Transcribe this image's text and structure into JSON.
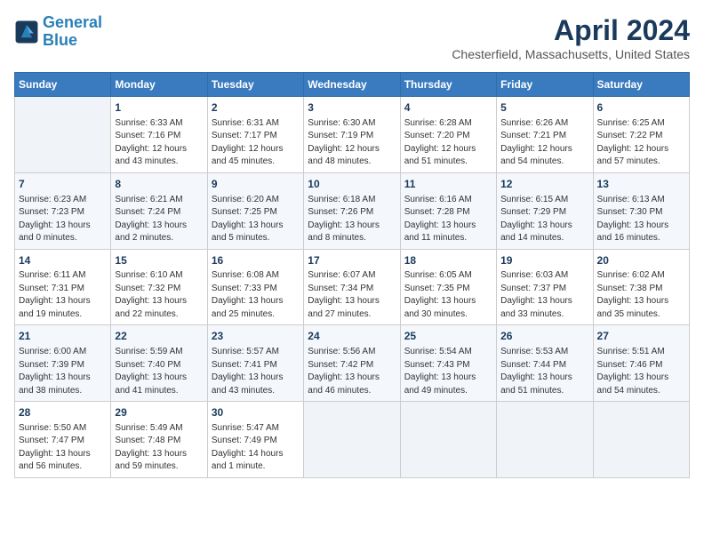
{
  "header": {
    "logo_line1": "General",
    "logo_line2": "Blue",
    "month": "April 2024",
    "location": "Chesterfield, Massachusetts, United States"
  },
  "weekdays": [
    "Sunday",
    "Monday",
    "Tuesday",
    "Wednesday",
    "Thursday",
    "Friday",
    "Saturday"
  ],
  "weeks": [
    [
      {
        "day": "",
        "info": ""
      },
      {
        "day": "1",
        "info": "Sunrise: 6:33 AM\nSunset: 7:16 PM\nDaylight: 12 hours\nand 43 minutes."
      },
      {
        "day": "2",
        "info": "Sunrise: 6:31 AM\nSunset: 7:17 PM\nDaylight: 12 hours\nand 45 minutes."
      },
      {
        "day": "3",
        "info": "Sunrise: 6:30 AM\nSunset: 7:19 PM\nDaylight: 12 hours\nand 48 minutes."
      },
      {
        "day": "4",
        "info": "Sunrise: 6:28 AM\nSunset: 7:20 PM\nDaylight: 12 hours\nand 51 minutes."
      },
      {
        "day": "5",
        "info": "Sunrise: 6:26 AM\nSunset: 7:21 PM\nDaylight: 12 hours\nand 54 minutes."
      },
      {
        "day": "6",
        "info": "Sunrise: 6:25 AM\nSunset: 7:22 PM\nDaylight: 12 hours\nand 57 minutes."
      }
    ],
    [
      {
        "day": "7",
        "info": "Sunrise: 6:23 AM\nSunset: 7:23 PM\nDaylight: 13 hours\nand 0 minutes."
      },
      {
        "day": "8",
        "info": "Sunrise: 6:21 AM\nSunset: 7:24 PM\nDaylight: 13 hours\nand 2 minutes."
      },
      {
        "day": "9",
        "info": "Sunrise: 6:20 AM\nSunset: 7:25 PM\nDaylight: 13 hours\nand 5 minutes."
      },
      {
        "day": "10",
        "info": "Sunrise: 6:18 AM\nSunset: 7:26 PM\nDaylight: 13 hours\nand 8 minutes."
      },
      {
        "day": "11",
        "info": "Sunrise: 6:16 AM\nSunset: 7:28 PM\nDaylight: 13 hours\nand 11 minutes."
      },
      {
        "day": "12",
        "info": "Sunrise: 6:15 AM\nSunset: 7:29 PM\nDaylight: 13 hours\nand 14 minutes."
      },
      {
        "day": "13",
        "info": "Sunrise: 6:13 AM\nSunset: 7:30 PM\nDaylight: 13 hours\nand 16 minutes."
      }
    ],
    [
      {
        "day": "14",
        "info": "Sunrise: 6:11 AM\nSunset: 7:31 PM\nDaylight: 13 hours\nand 19 minutes."
      },
      {
        "day": "15",
        "info": "Sunrise: 6:10 AM\nSunset: 7:32 PM\nDaylight: 13 hours\nand 22 minutes."
      },
      {
        "day": "16",
        "info": "Sunrise: 6:08 AM\nSunset: 7:33 PM\nDaylight: 13 hours\nand 25 minutes."
      },
      {
        "day": "17",
        "info": "Sunrise: 6:07 AM\nSunset: 7:34 PM\nDaylight: 13 hours\nand 27 minutes."
      },
      {
        "day": "18",
        "info": "Sunrise: 6:05 AM\nSunset: 7:35 PM\nDaylight: 13 hours\nand 30 minutes."
      },
      {
        "day": "19",
        "info": "Sunrise: 6:03 AM\nSunset: 7:37 PM\nDaylight: 13 hours\nand 33 minutes."
      },
      {
        "day": "20",
        "info": "Sunrise: 6:02 AM\nSunset: 7:38 PM\nDaylight: 13 hours\nand 35 minutes."
      }
    ],
    [
      {
        "day": "21",
        "info": "Sunrise: 6:00 AM\nSunset: 7:39 PM\nDaylight: 13 hours\nand 38 minutes."
      },
      {
        "day": "22",
        "info": "Sunrise: 5:59 AM\nSunset: 7:40 PM\nDaylight: 13 hours\nand 41 minutes."
      },
      {
        "day": "23",
        "info": "Sunrise: 5:57 AM\nSunset: 7:41 PM\nDaylight: 13 hours\nand 43 minutes."
      },
      {
        "day": "24",
        "info": "Sunrise: 5:56 AM\nSunset: 7:42 PM\nDaylight: 13 hours\nand 46 minutes."
      },
      {
        "day": "25",
        "info": "Sunrise: 5:54 AM\nSunset: 7:43 PM\nDaylight: 13 hours\nand 49 minutes."
      },
      {
        "day": "26",
        "info": "Sunrise: 5:53 AM\nSunset: 7:44 PM\nDaylight: 13 hours\nand 51 minutes."
      },
      {
        "day": "27",
        "info": "Sunrise: 5:51 AM\nSunset: 7:46 PM\nDaylight: 13 hours\nand 54 minutes."
      }
    ],
    [
      {
        "day": "28",
        "info": "Sunrise: 5:50 AM\nSunset: 7:47 PM\nDaylight: 13 hours\nand 56 minutes."
      },
      {
        "day": "29",
        "info": "Sunrise: 5:49 AM\nSunset: 7:48 PM\nDaylight: 13 hours\nand 59 minutes."
      },
      {
        "day": "30",
        "info": "Sunrise: 5:47 AM\nSunset: 7:49 PM\nDaylight: 14 hours\nand 1 minute."
      },
      {
        "day": "",
        "info": ""
      },
      {
        "day": "",
        "info": ""
      },
      {
        "day": "",
        "info": ""
      },
      {
        "day": "",
        "info": ""
      }
    ]
  ]
}
